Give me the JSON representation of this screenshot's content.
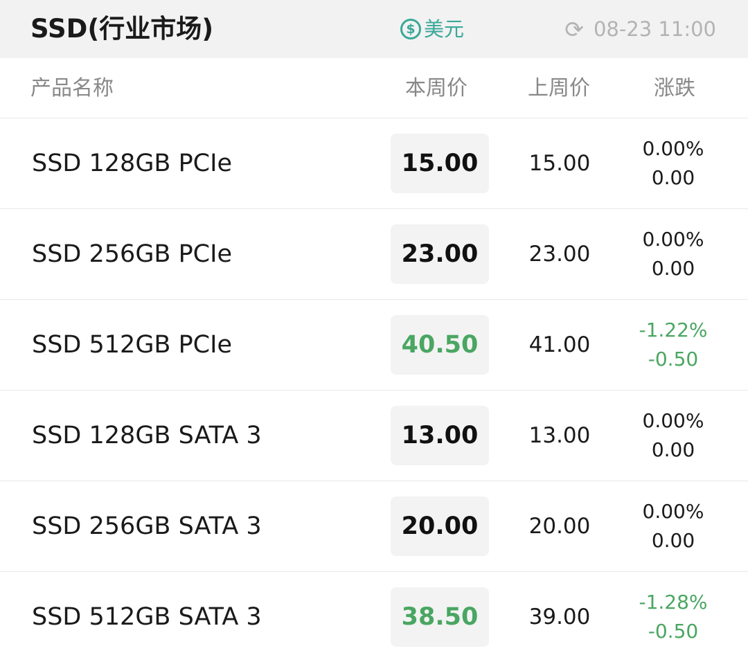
{
  "header": {
    "title": "SSD(行业市场)",
    "currency_symbol": "$",
    "currency_label": "美元",
    "update_time": "08-23 11:00"
  },
  "columns": {
    "name": "产品名称",
    "this_week": "本周价",
    "last_week": "上周价",
    "change": "涨跌"
  },
  "colors": {
    "accent": "#3aa898",
    "down": "#4aa662"
  },
  "rows": [
    {
      "name": "SSD 128GB PCIe",
      "this_week": "15.00",
      "last_week": "15.00",
      "change_pct": "0.00%",
      "change_abs": "0.00",
      "trend": "flat"
    },
    {
      "name": "SSD 256GB PCIe",
      "this_week": "23.00",
      "last_week": "23.00",
      "change_pct": "0.00%",
      "change_abs": "0.00",
      "trend": "flat"
    },
    {
      "name": "SSD 512GB PCIe",
      "this_week": "40.50",
      "last_week": "41.00",
      "change_pct": "-1.22%",
      "change_abs": "-0.50",
      "trend": "down"
    },
    {
      "name": "SSD 128GB SATA 3",
      "this_week": "13.00",
      "last_week": "13.00",
      "change_pct": "0.00%",
      "change_abs": "0.00",
      "trend": "flat"
    },
    {
      "name": "SSD 256GB SATA 3",
      "this_week": "20.00",
      "last_week": "20.00",
      "change_pct": "0.00%",
      "change_abs": "0.00",
      "trend": "flat"
    },
    {
      "name": "SSD 512GB SATA 3",
      "this_week": "38.50",
      "last_week": "39.00",
      "change_pct": "-1.28%",
      "change_abs": "-0.50",
      "trend": "down"
    }
  ]
}
